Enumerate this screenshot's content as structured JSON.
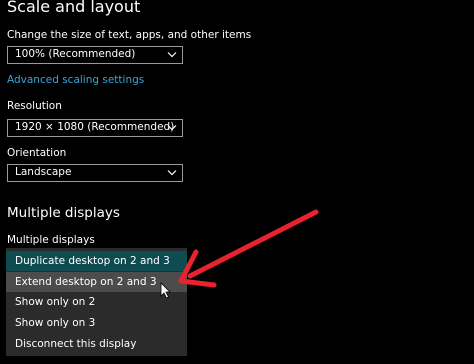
{
  "section_title": "Scale and layout",
  "scale": {
    "label": "Change the size of text, apps, and other items",
    "value": "100% (Recommended)"
  },
  "advanced_link": "Advanced scaling settings",
  "resolution": {
    "label": "Resolution",
    "value": "1920 × 1080 (Recommended)"
  },
  "orientation": {
    "label": "Orientation",
    "value": "Landscape"
  },
  "multiple_displays": {
    "heading": "Multiple displays",
    "label": "Multiple displays",
    "options": [
      "Duplicate desktop on 2 and 3",
      "Extend desktop on 2 and 3",
      "Show only on 2",
      "Show only on 3",
      "Disconnect this display"
    ],
    "selected_index": 0,
    "hovered_index": 1
  },
  "colors": {
    "accent_link": "#3aa3d8",
    "selected_bg": "#0f4c52",
    "hover_bg": "#4c4c4c",
    "annotation_arrow": "#e8232f"
  },
  "icons": {
    "dropdown": "chevron-down-icon",
    "cursor": "mouse-pointer-icon",
    "annotation": "red-arrow-annotation"
  }
}
